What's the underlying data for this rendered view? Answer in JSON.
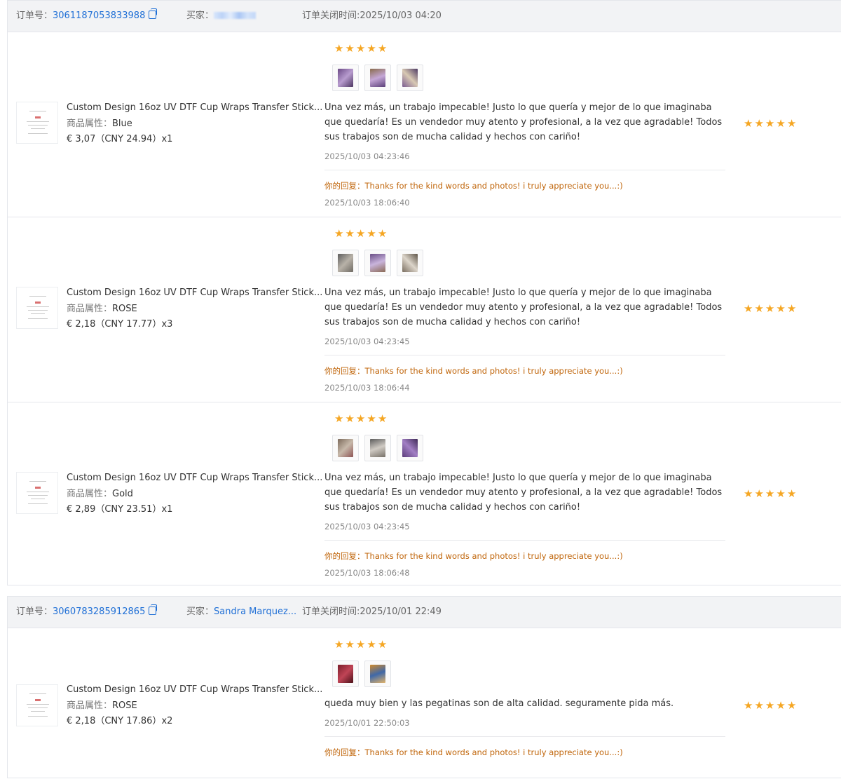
{
  "colors": {
    "accent_blue": "#1f6fd6",
    "star": "#f5a623",
    "reply": "#c0650a",
    "header_bg": "#f2f3f5"
  },
  "icons": {
    "star": "star-icon",
    "copy": "copy-icon"
  },
  "orders": [
    {
      "order_label": "订单号：",
      "order_no": "3061187053833988",
      "buyer_label": "买家：",
      "buyer_name": "",
      "close_time": "订单关闭时间:2025/10/03 04:20",
      "items": [
        {
          "title": "Custom Design 16oz UV DTF Cup Wraps Transfer Stick...",
          "attr_label": "商品属性：",
          "attr_value": "Blue",
          "price": "€ 3,07（CNY  24.94）x1",
          "review_stars": 5,
          "review_text": "Una vez más, un trabajo impecable! Justo lo que quería y mejor de lo que imaginaba que quedaría! Es un vendedor muy atento y profesional, a la vez que agradable! Todos sus trabajos son de mucha calidad y hechos con cariño!",
          "review_date": "2025/10/03 04:23:46",
          "reply_label": "你的回复：",
          "reply_text": "Thanks for the kind words and photos! i truly appreciate you...:)",
          "reply_date": "2025/10/03 18:06:40",
          "rating": 5
        },
        {
          "title": "Custom Design 16oz UV DTF Cup Wraps Transfer Stick...",
          "attr_label": "商品属性：",
          "attr_value": "ROSE",
          "price": "€ 2,18（CNY  17.77）x3",
          "review_stars": 5,
          "review_text": "Una vez más, un trabajo impecable! Justo lo que quería y mejor de lo que imaginaba que quedaría! Es un vendedor muy atento y profesional, a la vez que agradable! Todos sus trabajos son de mucha calidad y hechos con cariño!",
          "review_date": "2025/10/03 04:23:45",
          "reply_label": "你的回复：",
          "reply_text": "Thanks for the kind words and photos! i truly appreciate you...:)",
          "reply_date": "2025/10/03 18:06:44",
          "rating": 5
        },
        {
          "title": "Custom Design 16oz UV DTF Cup Wraps Transfer Stick...",
          "attr_label": "商品属性：",
          "attr_value": "Gold",
          "price": "€ 2,89（CNY  23.51）x1",
          "review_stars": 5,
          "review_text": "Una vez más, un trabajo impecable! Justo lo que quería y mejor de lo que imaginaba que quedaría! Es un vendedor muy atento y profesional, a la vez que agradable! Todos sus trabajos son de mucha calidad y hechos con cariño!",
          "review_date": "2025/10/03 04:23:45",
          "reply_label": "你的回复：",
          "reply_text": "Thanks for the kind words and photos! i truly appreciate you...:)",
          "reply_date": "2025/10/03 18:06:48",
          "rating": 5
        }
      ]
    },
    {
      "order_label": "订单号：",
      "order_no": "3060783285912865",
      "buyer_label": "买家：",
      "buyer_name": "Sandra Marquez...",
      "close_time": "订单关闭时间:2025/10/01 22:49",
      "items": [
        {
          "title": "Custom Design 16oz UV DTF Cup Wraps Transfer Stick...",
          "attr_label": "商品属性：",
          "attr_value": "ROSE",
          "price": "€ 2,18（CNY  17.86）x2",
          "review_stars": 5,
          "review_text": "queda muy bien y las pegatinas son de alta calidad. seguramente pida más.",
          "review_date": "2025/10/01 22:50:03",
          "reply_label": "你的回复：",
          "reply_text": "Thanks for the kind words and photos! i truly appreciate you...:)",
          "reply_date": "",
          "rating": 5
        }
      ]
    }
  ]
}
